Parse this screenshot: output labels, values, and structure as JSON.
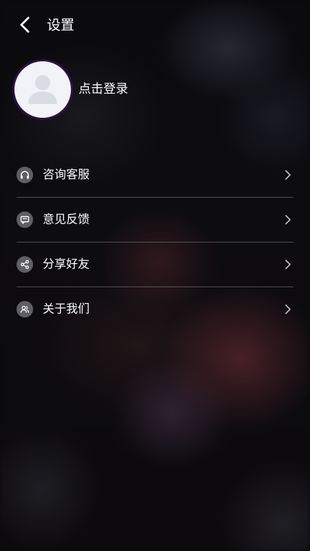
{
  "header": {
    "title": "设置",
    "back_icon": "chevron-left-icon"
  },
  "profile": {
    "login_text": "点击登录",
    "avatar_icon": "default-avatar-icon"
  },
  "menu": {
    "items": [
      {
        "label": "咨询客服",
        "icon": "headset-icon"
      },
      {
        "label": "意见反馈",
        "icon": "feedback-message-icon"
      },
      {
        "label": "分享好友",
        "icon": "share-icon"
      },
      {
        "label": "关于我们",
        "icon": "users-icon"
      }
    ]
  },
  "colors": {
    "avatar_ring": "#2a1246",
    "avatar_bg": "#f1f3f7",
    "icon_circle": "#5e5e64",
    "divider": "rgba(255,255,255,0.28)",
    "text": "#ffffff"
  }
}
